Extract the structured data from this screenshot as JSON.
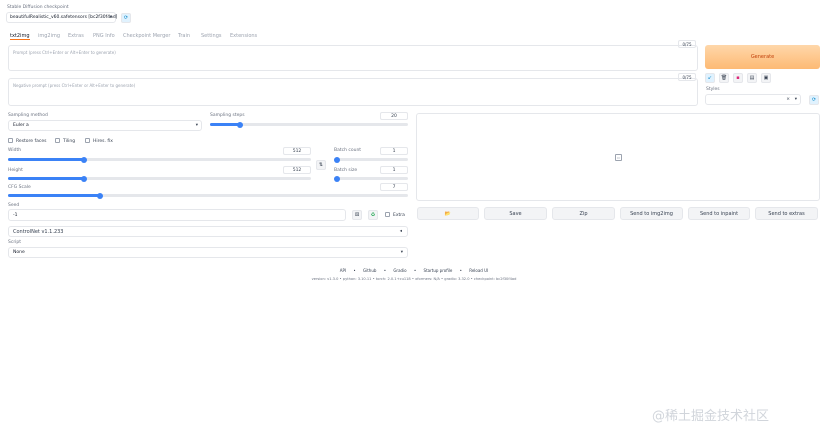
{
  "checkpoint": {
    "label": "Stable Diffusion checkpoint",
    "value": "beautifulRealistic_v60.safetensors [bc2f30f4ad]"
  },
  "tabs": [
    "txt2img",
    "img2img",
    "Extras",
    "PNG Info",
    "Checkpoint Merger",
    "Train",
    "Settings",
    "Extensions"
  ],
  "prompt": {
    "placeholder": "Prompt (press Ctrl+Enter or Alt+Enter to generate)",
    "counter": "0/75"
  },
  "negative_prompt": {
    "placeholder": "Negative prompt (press Ctrl+Enter or Alt+Enter to generate)",
    "counter": "0/75"
  },
  "generate_label": "Generate",
  "styles_label": "Styles",
  "sampling_method": {
    "label": "Sampling method",
    "value": "Euler a"
  },
  "sampling_steps": {
    "label": "Sampling steps",
    "value": "20",
    "fraction": 0.15
  },
  "checks": {
    "restore_faces": "Restore faces",
    "tiling": "Tiling",
    "hires_fix": "Hires. fix"
  },
  "width": {
    "label": "Width",
    "value": "512",
    "fraction": 0.25
  },
  "height": {
    "label": "Height",
    "value": "512",
    "fraction": 0.25
  },
  "batch_count": {
    "label": "Batch count",
    "value": "1",
    "fraction": 0.0
  },
  "batch_size": {
    "label": "Batch size",
    "value": "1",
    "fraction": 0.0
  },
  "cfg_scale": {
    "label": "CFG Scale",
    "value": "7",
    "fraction": 0.23
  },
  "seed": {
    "label": "Seed",
    "value": "-1",
    "extra_label": "Extra"
  },
  "controlnet": {
    "label": "ControlNet v1.1.233"
  },
  "script": {
    "label": "Script",
    "value": "None"
  },
  "output_buttons": [
    "Save",
    "Zip",
    "Send to img2img",
    "Send to inpaint",
    "Send to extras"
  ],
  "footer_links": [
    "API",
    "Github",
    "Gradio",
    "Startup profile",
    "Reload UI"
  ],
  "footer_versions": "version: v1.3.0 • python: 3.10.11 • torch: 2.0.1+cu118 • xformers: N/A • gradio: 3.32.0 • checkpoint: bc2f30f4ad",
  "watermark": "@稀土掘金技术社区"
}
